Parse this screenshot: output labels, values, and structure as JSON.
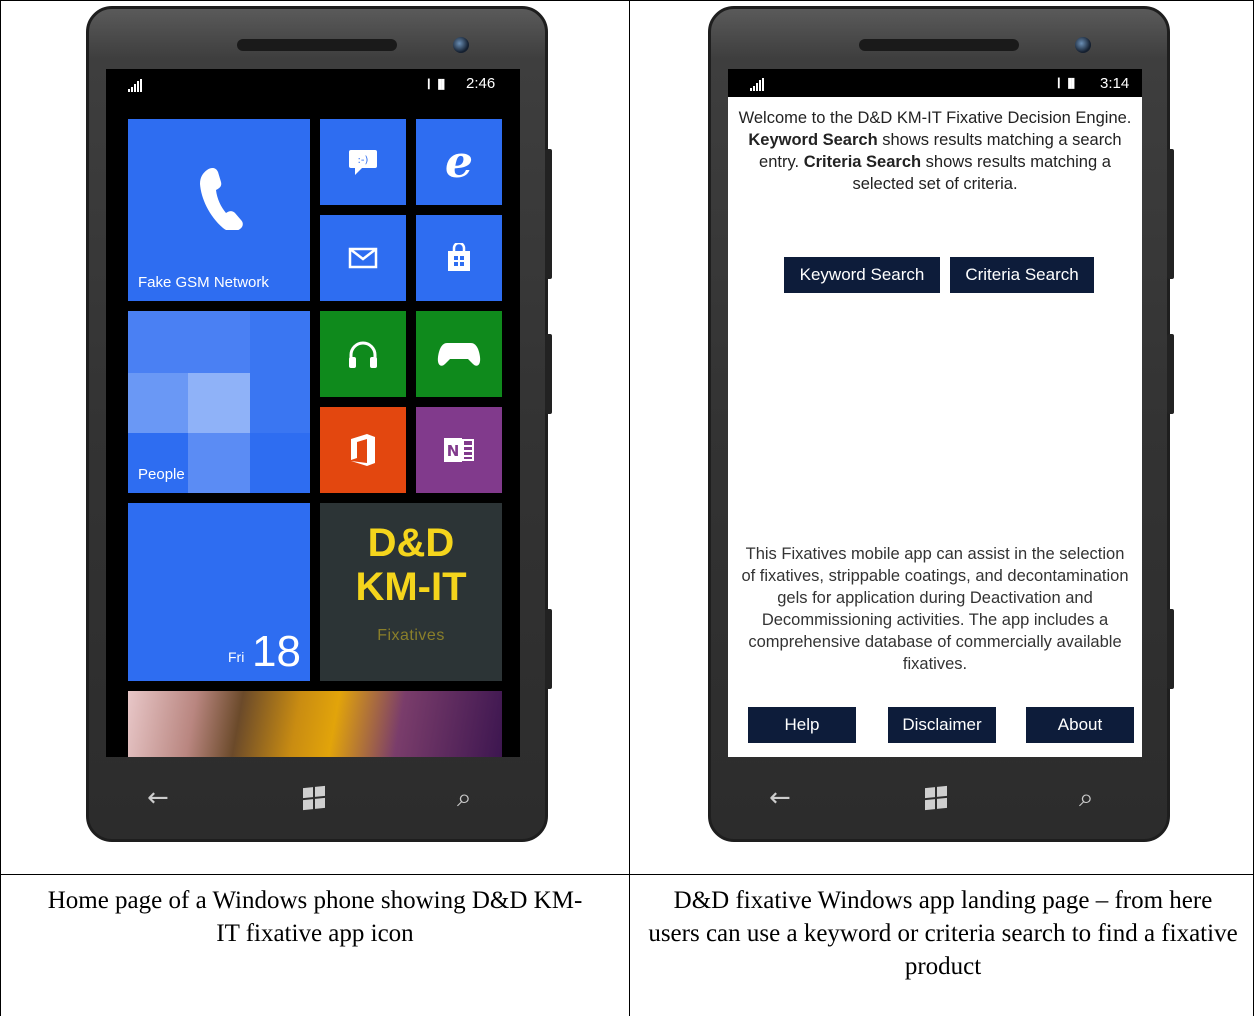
{
  "left_phone": {
    "status": {
      "time": "2:46",
      "battery": "▎▐▌"
    },
    "tiles": {
      "phone": {
        "label": "Fake GSM Network",
        "icon": "phone-icon"
      },
      "messaging": {
        "icon": "messaging-icon"
      },
      "ie": {
        "icon": "internet-explorer-icon"
      },
      "mail": {
        "icon": "mail-icon"
      },
      "store": {
        "icon": "store-icon"
      },
      "people": {
        "label": "People"
      },
      "music": {
        "icon": "headphones-icon"
      },
      "xbox": {
        "icon": "xbox-controller-icon"
      },
      "office": {
        "icon": "office-icon"
      },
      "onenote": {
        "icon": "onenote-icon"
      },
      "calendar": {
        "day": "Fri",
        "date": "18"
      },
      "app": {
        "line1": "D&D",
        "line2": "KM-IT",
        "line3": "Fixatives"
      }
    },
    "colors": {
      "tile_blue": "#2e6df1",
      "green": "#0f8a1c",
      "orange": "#e3470f",
      "purple": "#813a8c",
      "app_tile": "#2c3436",
      "app_gold": "#f5d51c"
    }
  },
  "right_phone": {
    "status": {
      "time": "3:14"
    },
    "welcome": {
      "t1": "Welcome to the D&D KM-IT Fixative Decision Engine. ",
      "b1": "Keyword Search",
      "t2": " shows results matching a search entry. ",
      "b2": "Criteria Search",
      "t3": " shows results matching a selected set of criteria."
    },
    "buttons": {
      "keyword": "Keyword Search",
      "criteria": "Criteria Search"
    },
    "description": "This Fixatives mobile app can assist in the selection of fixatives, strippable coatings, and decontamination gels for application during Deactivation and Decommissioning activities. The app includes a comprehensive database of commercially available fixatives.",
    "bottom_buttons": {
      "help": "Help",
      "disclaimer": "Disclaimer",
      "about": "About"
    },
    "colors": {
      "button_navy": "#0d1c3a"
    }
  },
  "nav": {
    "back": "←",
    "search": "⌕"
  },
  "captions": {
    "left": "Home page of a Windows phone showing D&D KM-IT fixative app icon",
    "right": "D&D fixative Windows app landing page – from here users can use a keyword or criteria search to find a fixative product"
  }
}
